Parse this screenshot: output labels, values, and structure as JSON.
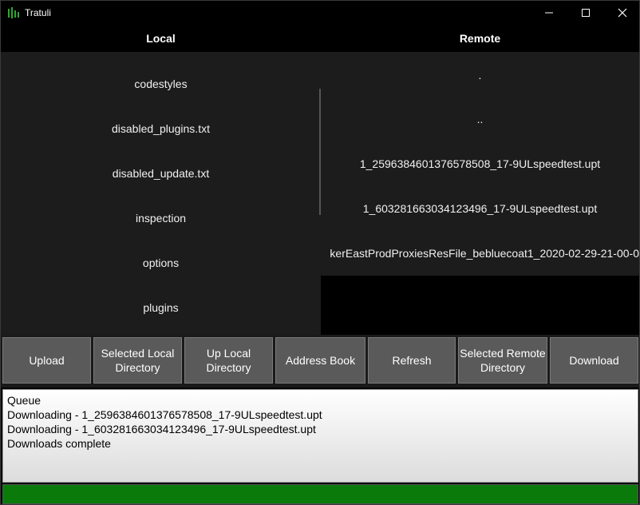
{
  "window": {
    "title": "Tratuli",
    "min_glyph": "—",
    "max_glyph": "☐",
    "close_glyph": "✕",
    "icon": "app-icon"
  },
  "headers": {
    "local": "Local",
    "remote": "Remote"
  },
  "local": {
    "items": [
      "codestyles",
      "disabled_plugins.txt",
      "disabled_update.txt",
      "inspection",
      "options",
      "plugins"
    ]
  },
  "remote": {
    "items": [
      ".",
      "..",
      "1_2596384601376578508_17-9ULspeedtest.upt",
      "1_603281663034123496_17-9ULspeedtest.upt",
      "kerEastProdProxiesResFile_bebluecoat1_2020-02-29-21-00-0"
    ]
  },
  "buttons": {
    "upload": "Upload",
    "selected_local_1": "Selected Local",
    "selected_local_2": "Directory",
    "up_local_1": "Up Local",
    "up_local_2": "Directory",
    "address_book": "Address Book",
    "refresh": "Refresh",
    "selected_remote_1": "Selected Remote",
    "selected_remote_2": "Directory",
    "download": "Download"
  },
  "log": {
    "lines": [
      "Queue",
      "Downloading - 1_2596384601376578508_17-9ULspeedtest.upt",
      "Downloading - 1_603281663034123496_17-9ULspeedtest.upt",
      "Downloads complete"
    ]
  },
  "progress": {
    "percent": 100,
    "color": "#0a7a0a"
  }
}
